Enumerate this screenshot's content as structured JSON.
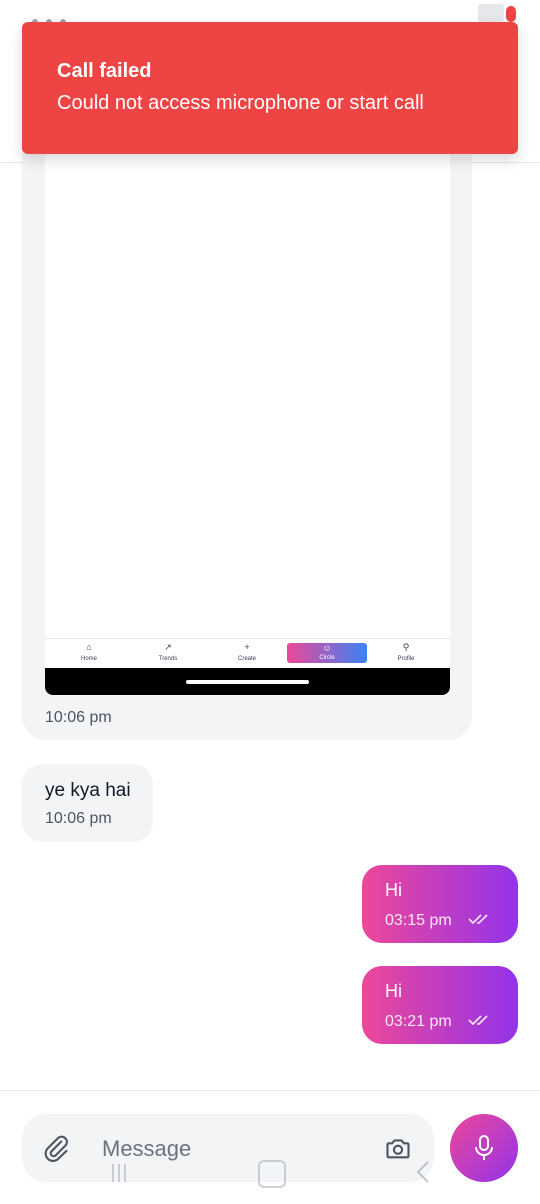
{
  "toast": {
    "title": "Call failed",
    "body": "Could not access microphone or start call",
    "color": "#ef4444"
  },
  "messages": {
    "image_message": {
      "time": "10:06 pm",
      "embedded_nav": {
        "items": [
          {
            "label": "Home",
            "icon": "home-icon",
            "glyph": "⌂"
          },
          {
            "label": "Trends",
            "icon": "trend-icon",
            "glyph": "↗"
          },
          {
            "label": "Create",
            "icon": "plus-icon",
            "glyph": "+"
          },
          {
            "label": "Circle",
            "icon": "users-icon",
            "glyph": "☺"
          },
          {
            "label": "Profile",
            "icon": "profile-icon",
            "glyph": "⚲"
          }
        ],
        "active": "Circle"
      }
    },
    "incoming": {
      "text": "ye kya hai",
      "time": "10:06 pm"
    },
    "outgoing": [
      {
        "text": "Hi",
        "time": "03:15 pm",
        "status": "read"
      },
      {
        "text": "Hi",
        "time": "03:21 pm",
        "status": "read"
      }
    ]
  },
  "composer": {
    "placeholder": "Message",
    "value": "",
    "attach_icon": "paperclip-icon",
    "camera_icon": "camera-icon",
    "mic_icon": "mic-icon"
  },
  "colors": {
    "bubble_out_start": "#ec4899",
    "bubble_out_end": "#9333ea",
    "bubble_in": "#f3f4f6"
  }
}
